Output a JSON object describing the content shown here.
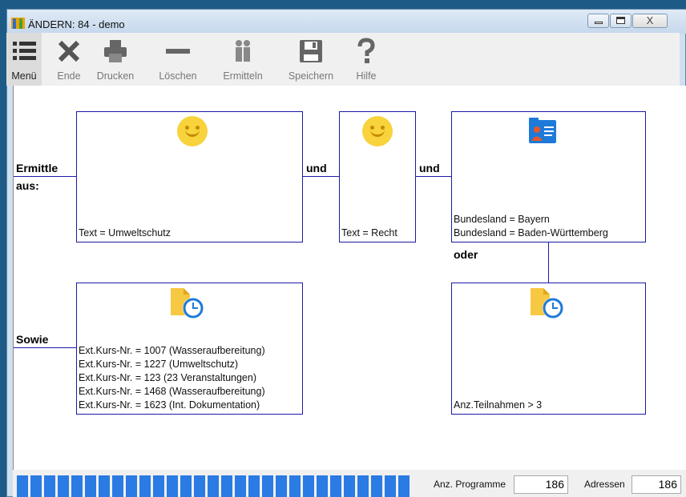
{
  "window": {
    "title": "ÄNDERN: 84 - demo",
    "close_glyph": "X"
  },
  "toolbar": {
    "items": [
      {
        "label": "Menü",
        "icon": "menu-icon"
      },
      {
        "label": "Ende",
        "icon": "close-x-icon"
      },
      {
        "label": "Drucken",
        "icon": "printer-icon"
      },
      {
        "label": "Löschen",
        "icon": "minus-icon"
      },
      {
        "label": "Ermitteln",
        "icon": "people-icon"
      },
      {
        "label": "Speichern",
        "icon": "save-icon"
      },
      {
        "label": "Hilfe",
        "icon": "help-icon"
      }
    ]
  },
  "diagram": {
    "ermittle_label": "Ermittle",
    "aus_label": "aus:",
    "und1": "und",
    "und2": "und",
    "oder": "oder",
    "sowie": "Sowie",
    "box1": {
      "icon": "smiley-icon",
      "lines": [
        "Text = Umweltschutz"
      ]
    },
    "box2": {
      "icon": "smiley-icon",
      "lines": [
        "Text = Recht"
      ]
    },
    "box3": {
      "icon": "contact-card-icon",
      "lines": [
        "Bundesland = Bayern",
        "Bundesland = Baden-Württemberg"
      ]
    },
    "box4": {
      "icon": "document-clock-icon",
      "lines": [
        "Ext.Kurs-Nr. = 1007 (Wasseraufbereitung)",
        "Ext.Kurs-Nr. = 1227 (Umweltschutz)",
        "Ext.Kurs-Nr. = 123 (23 Veranstaltungen)",
        "Ext.Kurs-Nr. = 1468 (Wasseraufbereitung)",
        "Ext.Kurs-Nr. = 1623 (Int. Dokumentation)"
      ]
    },
    "box5": {
      "icon": "document-clock-icon",
      "lines": [
        "Anz.Teilnahmen > 3"
      ]
    }
  },
  "status": {
    "programme_label": "Anz. Programme",
    "programme_value": "186",
    "adressen_label": "Adressen",
    "adressen_value": "186",
    "progress": 1.0,
    "accent": "#2a7be4"
  }
}
